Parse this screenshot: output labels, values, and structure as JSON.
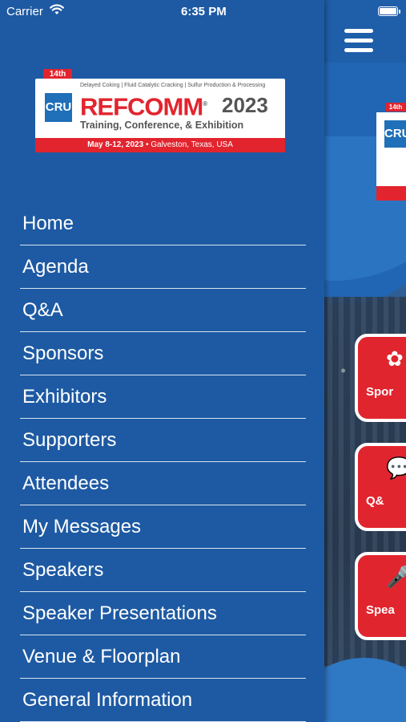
{
  "status_bar": {
    "carrier": "Carrier",
    "time": "6:35 PM"
  },
  "logo": {
    "edition": "14th",
    "brand_mark": "CRU",
    "topline": "Delayed Coking | Fluid Catalytic Cracking | Sulfur Production & Processing",
    "name": "REFCOMM",
    "registered": "®",
    "year": "2023",
    "subtitle": "Training, Conference, & Exhibition",
    "dates": "May 8-12, 2023",
    "location": "Galveston, Texas, USA"
  },
  "menu": {
    "items": [
      {
        "label": "Home"
      },
      {
        "label": "Agenda"
      },
      {
        "label": "Q&A"
      },
      {
        "label": "Sponsors"
      },
      {
        "label": "Exhibitors"
      },
      {
        "label": "Supporters"
      },
      {
        "label": "Attendees"
      },
      {
        "label": "My Messages"
      },
      {
        "label": "Speakers"
      },
      {
        "label": "Speaker Presentations"
      },
      {
        "label": "Venue & Floorplan"
      },
      {
        "label": "General Information"
      }
    ]
  },
  "background": {
    "mini_logo": {
      "edition": "14th",
      "brand_mark": "CRU"
    },
    "tiles": [
      {
        "label": "Spor",
        "icon": "ribbon-icon"
      },
      {
        "label": "Q&",
        "icon": "chat-bubbles-icon"
      },
      {
        "label": "Spea",
        "icon": "microphone-icon"
      }
    ]
  },
  "colors": {
    "brand_blue": "#1e5aa3",
    "brand_red": "#e2242e",
    "divider": "#d8e4f2"
  }
}
